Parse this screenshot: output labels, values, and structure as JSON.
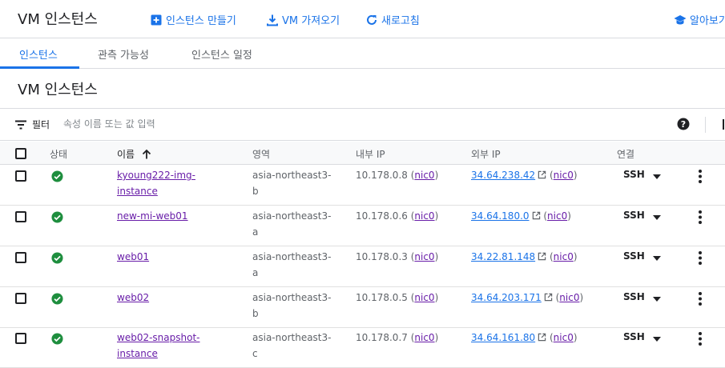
{
  "header": {
    "title": "VM 인스턴스",
    "actions": [
      {
        "label": "인스턴스 만들기",
        "icon": "add-box-icon"
      },
      {
        "label": "VM 가져오기",
        "icon": "download-icon"
      },
      {
        "label": "새로고침",
        "icon": "refresh-icon"
      },
      {
        "label": "알아보기",
        "icon": "school-icon"
      }
    ]
  },
  "tabs": [
    {
      "label": "인스턴스",
      "active": true
    },
    {
      "label": "관측 가능성",
      "active": false
    },
    {
      "label": "인스턴스 일정",
      "active": false
    }
  ],
  "section": {
    "title": "VM 인스턴스"
  },
  "filter": {
    "label": "필터",
    "placeholder": "속성 이름 또는 값 입력"
  },
  "table": {
    "columns": {
      "status": "상태",
      "name": "이름",
      "zone": "영역",
      "internal_ip": "내부 IP",
      "external_ip": "외부 IP",
      "connect": "연결"
    },
    "sort": {
      "column": "name",
      "direction": "ascending"
    },
    "rows": [
      {
        "name_line1": "kyoung222-img-",
        "name_line2": "instance",
        "zone_line1": "asia-northeast3-",
        "zone_line2": "b",
        "internal_ip": "10.178.0.8",
        "internal_nic": "nic0",
        "external_ip": "34.64.238.42",
        "external_nic": "nic0",
        "connect": "SSH",
        "status": "running"
      },
      {
        "name_line1": "new-mi-web01",
        "name_line2": "",
        "zone_line1": "asia-northeast3-",
        "zone_line2": "a",
        "internal_ip": "10.178.0.6",
        "internal_nic": "nic0",
        "external_ip": "34.64.180.0",
        "external_nic": "nic0",
        "connect": "SSH",
        "status": "running"
      },
      {
        "name_line1": "web01",
        "name_line2": "",
        "zone_line1": "asia-northeast3-",
        "zone_line2": "a",
        "internal_ip": "10.178.0.3",
        "internal_nic": "nic0",
        "external_ip": "34.22.81.148",
        "external_nic": "nic0",
        "connect": "SSH",
        "status": "running"
      },
      {
        "name_line1": "web02",
        "name_line2": "",
        "zone_line1": "asia-northeast3-",
        "zone_line2": "b",
        "internal_ip": "10.178.0.5",
        "internal_nic": "nic0",
        "external_ip": "34.64.203.171",
        "external_nic": "nic0",
        "connect": "SSH",
        "status": "running"
      },
      {
        "name_line1": "web02-snapshot-",
        "name_line2": "instance",
        "zone_line1": "asia-northeast3-",
        "zone_line2": "c",
        "internal_ip": "10.178.0.7",
        "internal_nic": "nic0",
        "external_ip": "34.64.161.80",
        "external_nic": "nic0",
        "connect": "SSH",
        "status": "running"
      }
    ]
  },
  "colors": {
    "accent": "#1a73e8",
    "visited_link": "#681da8",
    "status_ok": "#1e8e3e",
    "border": "#dadce0"
  }
}
